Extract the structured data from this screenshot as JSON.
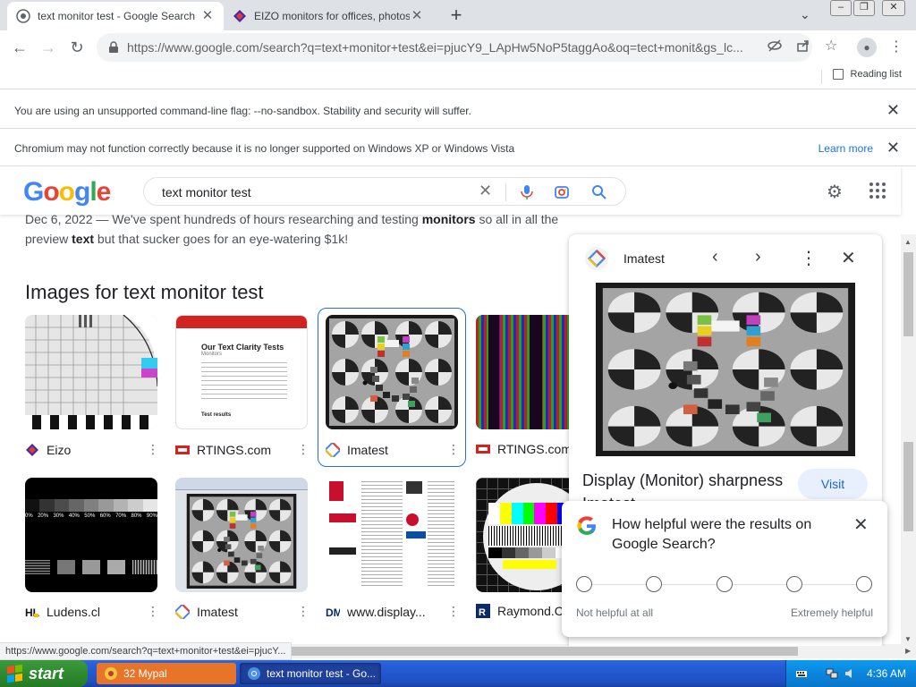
{
  "browser": {
    "tabs": [
      {
        "title": "text monitor test - Google Search",
        "active": true
      },
      {
        "title": "EIZO monitors for offices, photos & ...",
        "active": false
      }
    ],
    "url": "https://www.google.com/search?q=text+monitor+test&ei=pjucY9_LApHw5NoP5taggAo&oq=tect+monit&gs_lc...",
    "reading_list": "Reading list",
    "new_tab_icon": "+",
    "status_url": "https://www.google.com/search?q=text+monitor+test&ei=pjucY..."
  },
  "infobars": [
    {
      "message": "You are using an unsupported command-line flag: --no-sandbox. Stability and security will suffer."
    },
    {
      "message": "Chromium may not function correctly because it is no longer supported on Windows XP or Windows Vista",
      "link": "Learn more"
    }
  ],
  "search": {
    "query": "text monitor test",
    "logo_letters": [
      "G",
      "o",
      "o",
      "g",
      "l",
      "e"
    ]
  },
  "results": {
    "snippet_line1_start": "Dec 6, 2022 — We've spent hundreds of hours researching and testing ",
    "snippet_line1_bold": "monitors",
    "snippet_line1_end": " so all in all the",
    "snippet_line2_start": "preview ",
    "snippet_line2_bold": "text",
    "snippet_line2_end": " but that sucker goes for an eye-watering $1k!",
    "images_heading": "Images for text monitor test",
    "images": [
      {
        "source": "Eizo"
      },
      {
        "source": "RTINGS.com"
      },
      {
        "source": "Imatest"
      },
      {
        "source": "RTINGS.com"
      },
      {
        "source": "Ludens.cl"
      },
      {
        "source": "Imatest"
      },
      {
        "source": "www.display..."
      },
      {
        "source": "Raymond.C"
      }
    ],
    "rtings_thumb_title": "Our Text Clarity Tests",
    "rtings_thumb_sub": "Monitors",
    "rtings_thumb_result": "Test results",
    "ludens_labels": [
      "0%",
      "20%",
      "30%",
      "40%",
      "50%",
      "60%",
      "70%",
      "80%",
      "90%"
    ]
  },
  "preview": {
    "source": "Imatest",
    "title": "Display (Monitor) sharpness",
    "subtitle": "Imatest",
    "visit": "Visit"
  },
  "feedback": {
    "question": "How helpful were the results on Google Search?",
    "low_label": "Not helpful at all",
    "high_label": "Extremely helpful",
    "options": 5
  },
  "taskbar": {
    "start": "start",
    "tasks": [
      {
        "label": "32 Mypal"
      },
      {
        "label": "text monitor test - Go..."
      }
    ],
    "clock": "4:36 AM"
  },
  "colors": {
    "google_blue": "#4285f4",
    "google_red": "#ea4335",
    "google_yellow": "#fbbc05",
    "google_green": "#34a853",
    "link_blue": "#1a73e8"
  }
}
